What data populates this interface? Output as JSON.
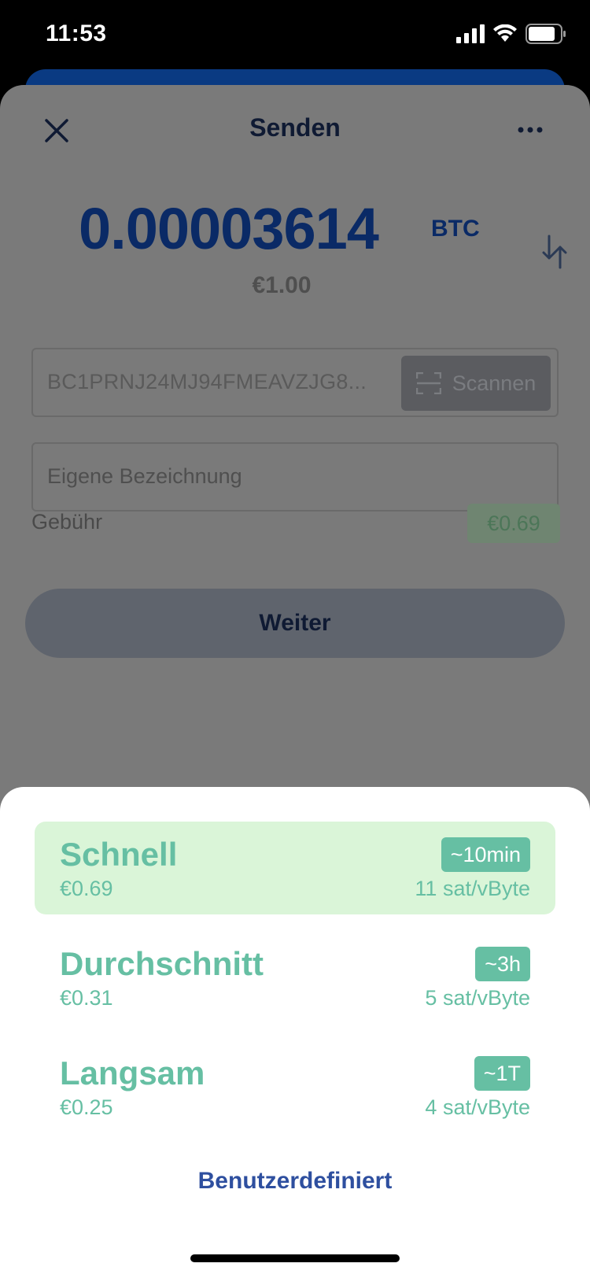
{
  "status_bar": {
    "time": "11:53"
  },
  "send": {
    "title": "Senden",
    "amount": "0.00003614",
    "unit": "BTC",
    "fiat": "€1.00",
    "address": "BC1PRNJ24MJ94FMEAVZJG8...",
    "scan_label": "Scannen",
    "label_placeholder": "Eigene Bezeichnung",
    "fee_label": "Gebühr",
    "fee_value": "€0.69",
    "next_label": "Weiter"
  },
  "fee_sheet": {
    "options": [
      {
        "name": "Schnell",
        "price": "€0.69",
        "time": "~10min",
        "rate": "11 sat/vByte",
        "selected": true
      },
      {
        "name": "Durchschnitt",
        "price": "€0.31",
        "time": "~3h",
        "rate": "5 sat/vByte",
        "selected": false
      },
      {
        "name": "Langsam",
        "price": "€0.25",
        "time": "~1T",
        "rate": "4 sat/vByte",
        "selected": false
      }
    ],
    "custom_label": "Benutzerdefiniert"
  },
  "colors": {
    "accent_green": "#66bfa3",
    "selected_bg": "#daf5d8",
    "link_blue": "#2e4f9f",
    "amount_blue": "#0a2a66"
  },
  "icons": [
    "signal-icon",
    "wifi-icon",
    "battery-icon",
    "close-icon",
    "more-icon",
    "swap-icon",
    "scan-icon"
  ]
}
